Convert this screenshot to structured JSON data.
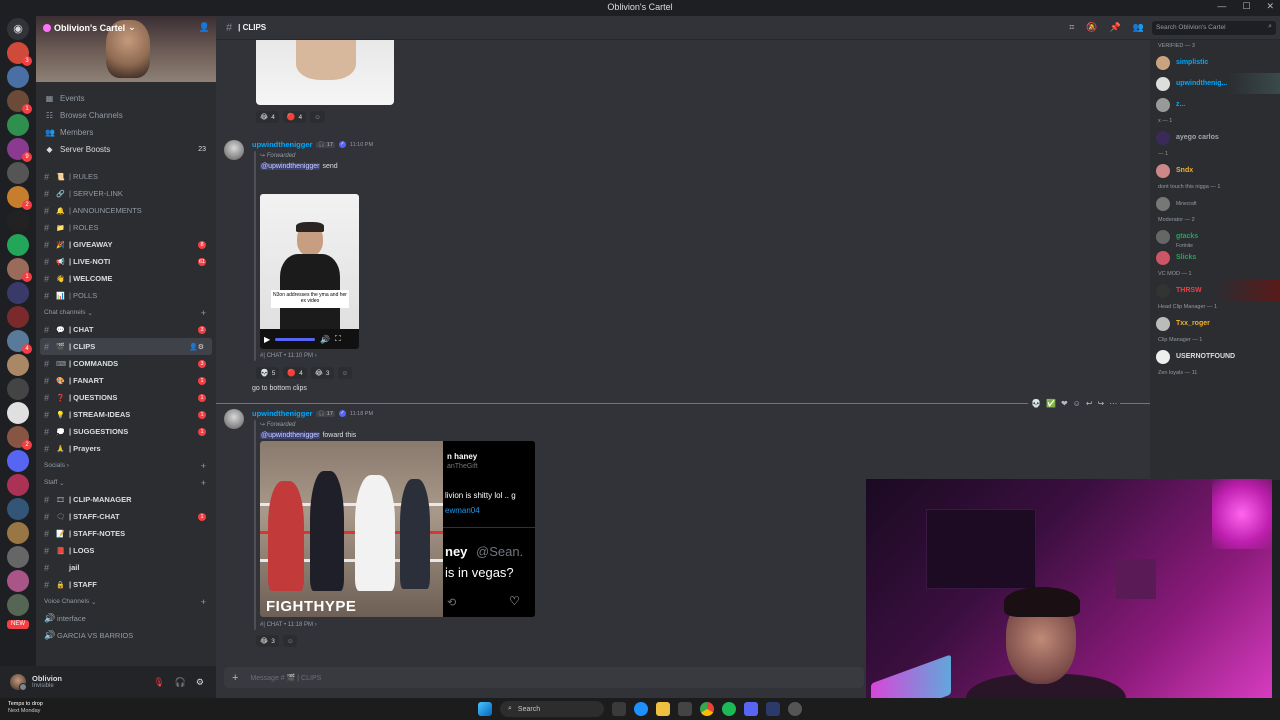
{
  "window": {
    "title": "Oblivion's Cartel"
  },
  "server": {
    "name": "Oblivion's Cartel",
    "menu": [
      {
        "icon": "calendar-icon",
        "label": "Events"
      },
      {
        "icon": "browse-icon",
        "label": "Browse Channels"
      },
      {
        "icon": "members-icon",
        "label": "Members"
      },
      {
        "icon": "boost-icon",
        "label": "Server Boosts",
        "count": "23"
      }
    ]
  },
  "channels": {
    "info": [
      {
        "emoji": "📜",
        "name": "| RULES",
        "muted": true
      },
      {
        "emoji": "🔗",
        "name": "| SERVER-LINK",
        "muted": true
      },
      {
        "emoji": "🔔",
        "name": "| ANNOUNCEMENTS",
        "muted": true
      },
      {
        "emoji": "📁",
        "name": "| ROLES",
        "muted": true
      },
      {
        "emoji": "🎉",
        "name": "| GIVEAWAY",
        "badge": "8"
      },
      {
        "emoji": "📢",
        "name": "| LIVE-NOTI",
        "badge": "61"
      },
      {
        "emoji": "👋",
        "name": "| WELCOME"
      },
      {
        "emoji": "📊",
        "name": "| POLLS",
        "muted": true
      }
    ],
    "chat_category": "Chat channels",
    "chat": [
      {
        "emoji": "💬",
        "name": "| CHAT",
        "badge": "3"
      },
      {
        "emoji": "🎬",
        "name": "| CLIPS",
        "selected": true
      },
      {
        "emoji": "⌨",
        "name": "| COMMANDS",
        "badge": "3"
      },
      {
        "emoji": "🎨",
        "name": "| FANART",
        "badge": "1"
      },
      {
        "emoji": "❓",
        "name": "| QUESTIONS",
        "badge": "1"
      },
      {
        "emoji": "💡",
        "name": "| STREAM-IDEAS",
        "badge": "1"
      },
      {
        "emoji": "💭",
        "name": "| SUGGESTIONS",
        "badge": "1"
      },
      {
        "emoji": "🙏",
        "name": "| Prayers"
      }
    ],
    "socials_category": "Socials",
    "staff_category": "Staff",
    "staff": [
      {
        "emoji": "🎞",
        "name": "| CLIP-MANAGER"
      },
      {
        "emoji": "🗨",
        "name": "| STAFF-CHAT",
        "badge": "1"
      },
      {
        "emoji": "📝",
        "name": "| STAFF-NOTES"
      },
      {
        "emoji": "📕",
        "name": "| LOGS"
      },
      {
        "emoji": "",
        "name": "jail"
      },
      {
        "emoji": "🔒",
        "name": "| STAFF"
      }
    ],
    "voice_category": "Voice Channels",
    "voice": [
      {
        "name": "interface"
      },
      {
        "name": "GARCIA VS BARRIOS"
      }
    ]
  },
  "user": {
    "name": "Oblivion",
    "status": "Invisible"
  },
  "rail": {
    "new_label": "NEW"
  },
  "header": {
    "channel": "| CLIPS",
    "search_placeholder": "Search Oblivion's Cartel"
  },
  "messages": {
    "top_reactions": [
      {
        "e": "😂",
        "n": "4"
      },
      {
        "e": "🔴",
        "n": "4"
      }
    ],
    "msg1": {
      "user": "upwindthenigger",
      "tag": "🎧 17",
      "time": "11:10 PM",
      "forwarded": "Forwarded",
      "mention": "@upwindthenigger",
      "text": "send",
      "caption": "N3on addresses the yma and her ex video",
      "source": "| CHAT • 11:10 PM",
      "reactions": [
        {
          "e": "💀",
          "n": "5"
        },
        {
          "e": "🔴",
          "n": "4"
        },
        {
          "e": "😂",
          "n": "3"
        }
      ]
    },
    "between": "go to bottom clips",
    "msg2": {
      "user": "upwindthenigger",
      "tag": "🎧 17",
      "time": "11:18 PM",
      "forwarded": "Forwarded",
      "mention": "@upwindthenigger",
      "text": "foward this",
      "video_logo": "FIGHTHYPE",
      "tweet_name": "n haney",
      "tweet_handle": "anTheGift",
      "tweet_text": "livion is shitty lol .. g",
      "tweet_mention": "ewman04",
      "tweet_big1": "ney",
      "tweet_big_handle": "@Sean.",
      "tweet_big2": "is in vegas?",
      "source": "| CHAT • 11:18 PM",
      "reactions": [
        {
          "e": "😂",
          "n": "3"
        }
      ]
    }
  },
  "composer": {
    "placeholder": "Message # 🎬 | CLIPS"
  },
  "members": [
    {
      "group": "VERIFIED — 3"
    },
    {
      "name": "simplistic",
      "color": "#00a8fc"
    },
    {
      "name": "upwindthenig...",
      "color": "#00a8fc"
    },
    {
      "name": "z...",
      "color": "#00a8fc"
    },
    {
      "group": "x — 1"
    },
    {
      "name": "ayego carlos",
      "color": "#a3a6ac"
    },
    {
      "group": "— 1"
    },
    {
      "name": "Sndx",
      "color": "#f0b232"
    },
    {
      "group": "dont touch this nigga — 1"
    },
    {
      "name": "",
      "sub": "Minecraft",
      "color": "#dbdee1"
    },
    {
      "group": "Moderator — 2"
    },
    {
      "name": "gtacks",
      "sub": "Fortnite",
      "color": "#23a55a"
    },
    {
      "name": "Slicks",
      "color": "#23a55a"
    },
    {
      "group": "VC MOD — 1"
    },
    {
      "name": "THRSW",
      "color": "#f23f43"
    },
    {
      "group": "Head Clip Manager — 1"
    },
    {
      "name": "Txx_roger",
      "color": "#f0b232"
    },
    {
      "group": "Clip Manager — 1"
    },
    {
      "name": "USERNOTFOUND",
      "color": "#dbdee1"
    },
    {
      "group": "Zen loyals — 11"
    }
  ],
  "taskbar": {
    "weather_line1": "Temps to drop",
    "weather_line2": "Next Monday",
    "search_label": "Search"
  }
}
